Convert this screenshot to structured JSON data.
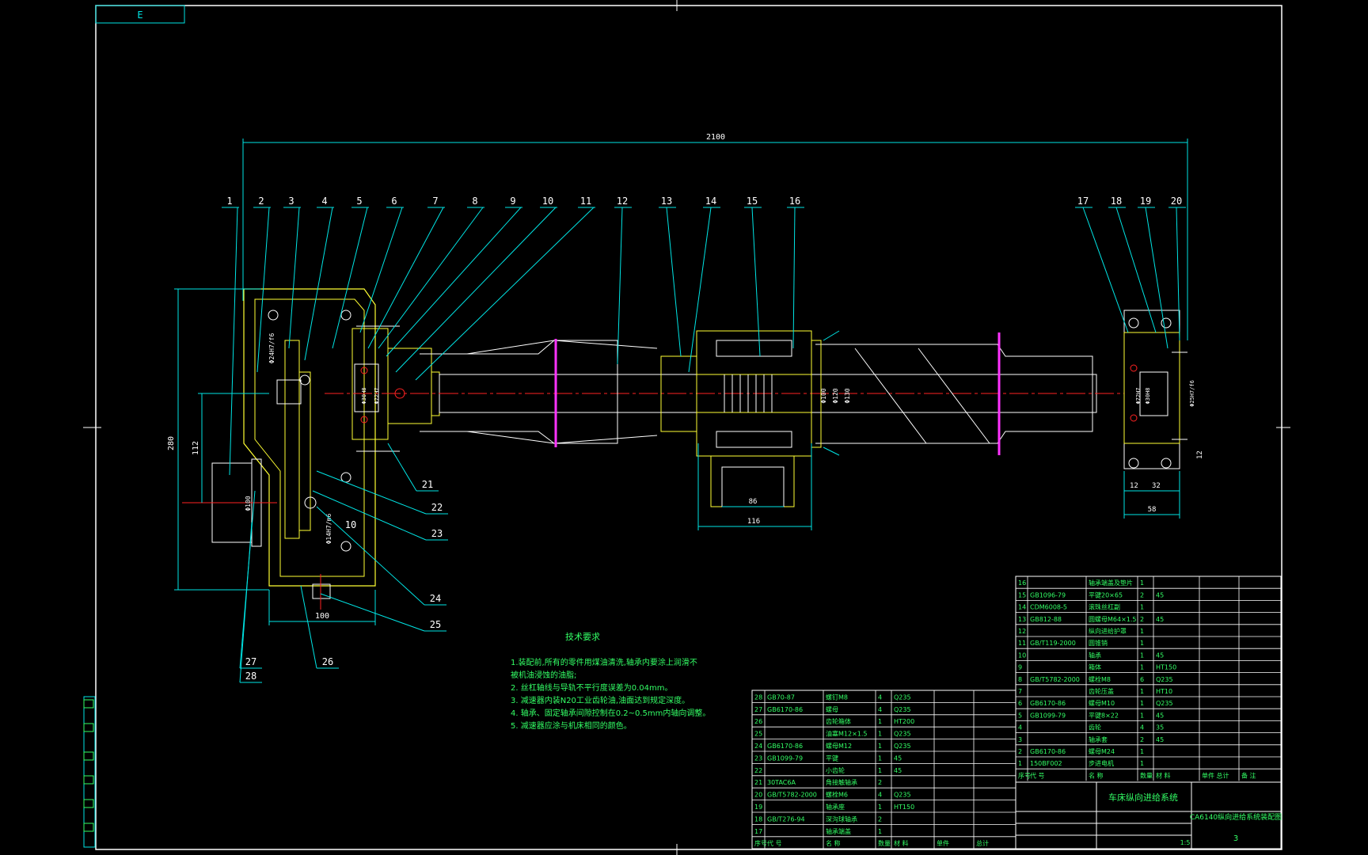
{
  "drawing": {
    "corner_tag": "E",
    "dims": {
      "overall_length": "2100",
      "gearbox_height": "280",
      "shaft_height": "112",
      "gearbox_width": "100",
      "nut_width": "86",
      "nut_flange": "116",
      "bearing_block_width": "58",
      "bb_a": "12",
      "bb_b": "32",
      "bb_c": "12",
      "dia_100": "Φ100",
      "dia_120": "Φ120",
      "dia_130": "Φ130",
      "fit_1": "Φ24H7/f6",
      "fit_2": "Φ14H7/m6",
      "fit_3": "Φ25H7/f6",
      "b1": "Φ30H8",
      "b2": "Φ72H7",
      "b3": "Φ30H8",
      "b4": "Φ72H7",
      "shaft_d": "Φ100"
    },
    "balloons_top": [
      "1",
      "2",
      "3",
      "4",
      "5",
      "6",
      "7",
      "8",
      "9",
      "10",
      "11",
      "12",
      "13",
      "14",
      "15",
      "16",
      "17",
      "18",
      "19",
      "20"
    ],
    "balloons_side": [
      "21",
      "22",
      "23",
      "24",
      "25",
      "26",
      "27",
      "28",
      "10"
    ]
  },
  "notes": {
    "title": "技术要求",
    "lines": [
      "1.装配前,所有的零件用煤油清洗,轴承内要涂上润滑不",
      "  被机油浸蚀的油脂;",
      "2. 丝杠轴线与导轨不平行度误差为0.04mm。",
      "3. 减速器内装N20工业齿轮油,油面达到规定深度。",
      "4. 轴承、固定轴承间隙控制在0.2~0.5mm内轴向调整。",
      "5. 减速器应涂与机床相同的颜色。"
    ]
  },
  "bom_right": {
    "rows": [
      [
        "16",
        "",
        "轴承端盖及垫片",
        "1",
        "",
        ""
      ],
      [
        "15",
        "GB1096-79",
        "平键20×65",
        "2",
        "45",
        ""
      ],
      [
        "14",
        "CDM6008-5",
        "滚珠丝杠副",
        "1",
        "",
        ""
      ],
      [
        "13",
        "GB812-88",
        "圆螺母M64×1.5",
        "2",
        "45",
        ""
      ],
      [
        "12",
        "",
        "纵向进给护罩",
        "1",
        "",
        ""
      ],
      [
        "11",
        "GB/T119-2000",
        "圆锥销",
        "1",
        "",
        ""
      ],
      [
        "10",
        "",
        "轴承",
        "1",
        "45",
        ""
      ],
      [
        "9",
        "",
        "箱体",
        "1",
        "HT150",
        ""
      ],
      [
        "8",
        "GB/T5782-2000",
        "螺栓M8",
        "6",
        "Q235",
        ""
      ],
      [
        "7",
        "",
        "齿轮压盖",
        "1",
        "HT10",
        ""
      ],
      [
        "6",
        "GB6170-86",
        "螺母M10",
        "1",
        "Q235",
        ""
      ],
      [
        "5",
        "GB1099-79",
        "平键8×22",
        "1",
        "45",
        ""
      ],
      [
        "4",
        "",
        "齿轮",
        "4",
        "35",
        ""
      ],
      [
        "3",
        "",
        "轴承套",
        "2",
        "45",
        ""
      ],
      [
        "2",
        "GB6170-86",
        "螺母M24",
        "1",
        "",
        ""
      ],
      [
        "1",
        "150BF002",
        "步进电机",
        "1",
        "",
        ""
      ]
    ],
    "header": [
      "序号",
      "代 号",
      "名 称",
      "数量",
      "材 料",
      "单件 总计",
      "备 注"
    ]
  },
  "bom_left": {
    "rows": [
      [
        "28",
        "GB70-87",
        "螺钉M8",
        "4",
        "Q235"
      ],
      [
        "27",
        "GB6170-86",
        "螺母",
        "4",
        "Q235"
      ],
      [
        "26",
        "",
        "齿轮箱体",
        "1",
        "HT200"
      ],
      [
        "25",
        "",
        "油塞M12×1.5",
        "1",
        "Q235"
      ],
      [
        "24",
        "GB6170-86",
        "螺母M12",
        "1",
        "Q235"
      ],
      [
        "23",
        "GB1099-79",
        "平键",
        "1",
        "45"
      ],
      [
        "22",
        "",
        "小齿轮",
        "1",
        "45"
      ],
      [
        "21",
        "30TAC6A",
        "角接触轴承",
        "2",
        ""
      ],
      [
        "20",
        "GB/T5782-2000",
        "螺栓M6",
        "4",
        "Q235"
      ],
      [
        "19",
        "",
        "轴承座",
        "1",
        "HT150"
      ],
      [
        "18",
        "GB/T276-94",
        "深沟球轴承",
        "2",
        ""
      ],
      [
        "17",
        "",
        "轴承端盖",
        "1",
        ""
      ]
    ],
    "footer": [
      "序号",
      "代 号",
      "名 称",
      "数量",
      "材 料",
      "单件",
      "总计",
      "备 注"
    ]
  },
  "title_block": {
    "title": "车床纵向进给系统",
    "drawing_no": "CA6140纵向进给系统装配图",
    "sheet": "3",
    "scale": "1:5"
  },
  "colors": {
    "cyan": "#00e5e5",
    "white": "#ffffff",
    "yellow": "#ffff33",
    "green": "#33ff66",
    "red": "#ff2222",
    "magenta": "#ff33ff",
    "background": "#000000"
  }
}
